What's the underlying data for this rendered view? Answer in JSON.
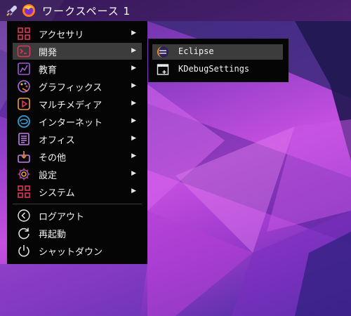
{
  "panel": {
    "launcher_icon": "rocket-icon",
    "browser_icon": "firefox-icon",
    "workspace_label": "ワークスペース 1"
  },
  "menu": {
    "items": [
      {
        "label": "アクセサリ",
        "icon": "accessories-grid-icon",
        "has_submenu": true
      },
      {
        "label": "開発",
        "icon": "terminal-icon",
        "has_submenu": true,
        "active": true
      },
      {
        "label": "教育",
        "icon": "education-chart-icon",
        "has_submenu": true
      },
      {
        "label": "グラフィックス",
        "icon": "palette-icon",
        "has_submenu": true
      },
      {
        "label": "マルチメディア",
        "icon": "play-icon",
        "has_submenu": true
      },
      {
        "label": "インターネット",
        "icon": "internet-icon",
        "has_submenu": true
      },
      {
        "label": "オフィス",
        "icon": "document-icon",
        "has_submenu": true
      },
      {
        "label": "その他",
        "icon": "package-icon",
        "has_submenu": true
      },
      {
        "label": "設定",
        "icon": "gear-icon",
        "has_submenu": true
      },
      {
        "label": "システム",
        "icon": "system-grid-icon",
        "has_submenu": true
      }
    ],
    "session": [
      {
        "label": "ログアウト",
        "icon": "logout-icon"
      },
      {
        "label": "再起動",
        "icon": "restart-icon"
      },
      {
        "label": "シャットダウン",
        "icon": "power-icon"
      }
    ],
    "arrow": "▶"
  },
  "submenu": {
    "items": [
      {
        "label": "Eclipse",
        "icon": "eclipse-icon",
        "active": true
      },
      {
        "label": "KDebugSettings",
        "icon": "window-icon"
      }
    ]
  },
  "colors": {
    "menu_bg": "#050505",
    "active_bg": "#3c3c3c",
    "accent_red": "#e0355a",
    "accent_purple": "#9b59d0"
  }
}
